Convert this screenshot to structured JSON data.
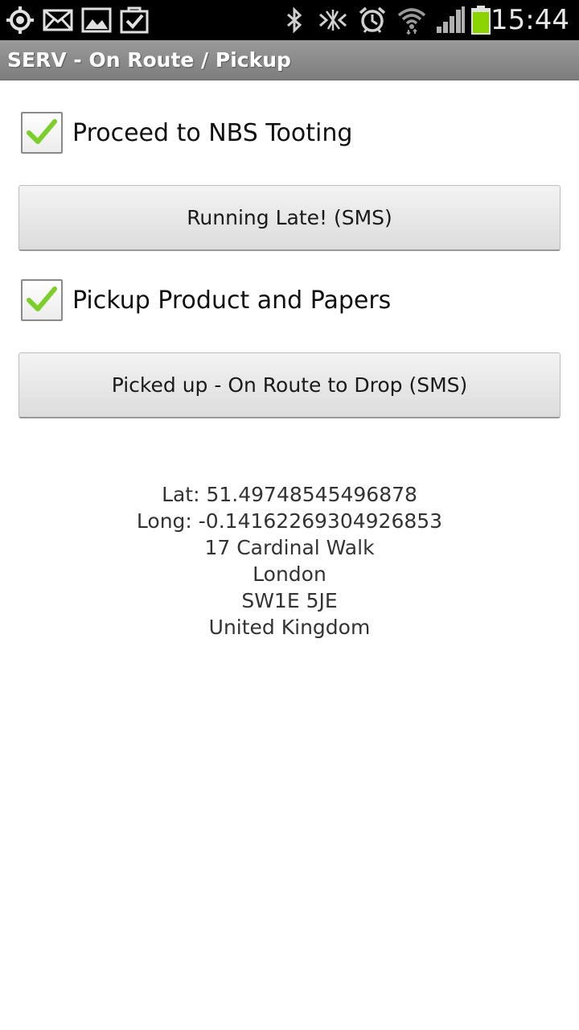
{
  "status_bar": {
    "time": "15:44",
    "left_icons": [
      "gps-icon",
      "mail-icon",
      "gallery-icon",
      "task-icon"
    ],
    "right_icons": [
      "bluetooth-icon",
      "nfc-icon",
      "alarm-icon",
      "wifi-icon",
      "signal-icon",
      "battery-icon"
    ],
    "battery_color": "#8bd400"
  },
  "app": {
    "title": "SERV - On Route / Pickup"
  },
  "steps": [
    {
      "label": "Proceed to NBS Tooting",
      "checked": true
    },
    {
      "label": "Pickup Product and Papers",
      "checked": true
    }
  ],
  "buttons": {
    "running_late": "Running Late! (SMS)",
    "picked_up": "Picked up - On Route to Drop (SMS)"
  },
  "location": {
    "lat": "Lat: 51.49748545496878",
    "long": "Long: -0.14162269304926853",
    "street": "17 Cardinal Walk",
    "city": "London",
    "postcode": "SW1E 5JE",
    "country": "United Kingdom"
  },
  "colors": {
    "check_mark": "#7ccf2a",
    "title_bar": "#8c8c8c"
  }
}
